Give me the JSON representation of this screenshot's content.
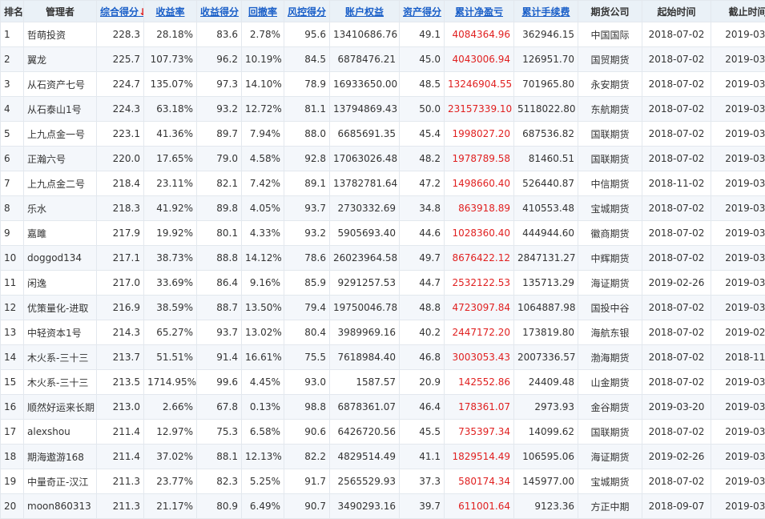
{
  "columns": [
    {
      "key": "rank",
      "label": "排名"
    },
    {
      "key": "manager",
      "label": "管理者"
    },
    {
      "key": "composite",
      "label": "综合得分",
      "sortable": true,
      "sort_indicator": "↓"
    },
    {
      "key": "return_rate",
      "label": "收益率",
      "sortable": true
    },
    {
      "key": "return_score",
      "label": "收益得分",
      "sortable": true
    },
    {
      "key": "drawdown",
      "label": "回撤率",
      "sortable": true
    },
    {
      "key": "risk_score",
      "label": "风控得分",
      "sortable": true
    },
    {
      "key": "equity",
      "label": "账户权益",
      "sortable": true
    },
    {
      "key": "asset_score",
      "label": "资产得分",
      "sortable": true
    },
    {
      "key": "net_profit",
      "label": "累计净盈亏",
      "sortable": true
    },
    {
      "key": "fees",
      "label": "累计手续费",
      "sortable": true
    },
    {
      "key": "broker",
      "label": "期货公司"
    },
    {
      "key": "start_date",
      "label": "起始时间"
    },
    {
      "key": "end_date",
      "label": "截止时间"
    }
  ],
  "accent_color": "#1a5fc8",
  "profit_color": "#e02020",
  "rows": [
    {
      "rank": "1",
      "manager": "哲萌投资",
      "composite": "228.3",
      "return_rate": "28.18%",
      "return_score": "83.6",
      "drawdown": "2.78%",
      "risk_score": "95.6",
      "equity": "13410686.76",
      "asset_score": "49.1",
      "net_profit": "4084364.96",
      "fees": "362946.15",
      "broker": "中国国际",
      "start_date": "2018-07-02",
      "end_date": "2019-03-28"
    },
    {
      "rank": "2",
      "manager": "翼龙",
      "composite": "225.7",
      "return_rate": "107.73%",
      "return_score": "96.2",
      "drawdown": "10.19%",
      "risk_score": "84.5",
      "equity": "6878476.21",
      "asset_score": "45.0",
      "net_profit": "4043006.94",
      "fees": "126951.70",
      "broker": "国贸期货",
      "start_date": "2018-07-02",
      "end_date": "2019-03-28"
    },
    {
      "rank": "3",
      "manager": "从石资产七号",
      "composite": "224.7",
      "return_rate": "135.07%",
      "return_score": "97.3",
      "drawdown": "14.10%",
      "risk_score": "78.9",
      "equity": "16933650.00",
      "asset_score": "48.5",
      "net_profit": "13246904.55",
      "fees": "701965.80",
      "broker": "永安期货",
      "start_date": "2018-07-02",
      "end_date": "2019-03-28"
    },
    {
      "rank": "4",
      "manager": "从石泰山1号",
      "composite": "224.3",
      "return_rate": "63.18%",
      "return_score": "93.2",
      "drawdown": "12.72%",
      "risk_score": "81.1",
      "equity": "13794869.43",
      "asset_score": "50.0",
      "net_profit": "23157339.10",
      "fees": "5118022.80",
      "broker": "东航期货",
      "start_date": "2018-07-02",
      "end_date": "2019-03-28"
    },
    {
      "rank": "5",
      "manager": "上九点金一号",
      "composite": "223.1",
      "return_rate": "41.36%",
      "return_score": "89.7",
      "drawdown": "7.94%",
      "risk_score": "88.0",
      "equity": "6685691.35",
      "asset_score": "45.4",
      "net_profit": "1998027.20",
      "fees": "687536.82",
      "broker": "国联期货",
      "start_date": "2018-07-02",
      "end_date": "2019-03-28"
    },
    {
      "rank": "6",
      "manager": "正瀚六号",
      "composite": "220.0",
      "return_rate": "17.65%",
      "return_score": "79.0",
      "drawdown": "4.58%",
      "risk_score": "92.8",
      "equity": "17063026.48",
      "asset_score": "48.2",
      "net_profit": "1978789.58",
      "fees": "81460.51",
      "broker": "国联期货",
      "start_date": "2018-07-02",
      "end_date": "2019-03-28"
    },
    {
      "rank": "7",
      "manager": "上九点金二号",
      "composite": "218.4",
      "return_rate": "23.11%",
      "return_score": "82.1",
      "drawdown": "7.42%",
      "risk_score": "89.1",
      "equity": "13782781.64",
      "asset_score": "47.2",
      "net_profit": "1498660.40",
      "fees": "526440.87",
      "broker": "中信期货",
      "start_date": "2018-11-02",
      "end_date": "2019-03-28"
    },
    {
      "rank": "8",
      "manager": "乐水",
      "composite": "218.3",
      "return_rate": "41.92%",
      "return_score": "89.8",
      "drawdown": "4.05%",
      "risk_score": "93.7",
      "equity": "2730332.69",
      "asset_score": "34.8",
      "net_profit": "863918.89",
      "fees": "410553.48",
      "broker": "宝城期货",
      "start_date": "2018-07-02",
      "end_date": "2019-03-28"
    },
    {
      "rank": "9",
      "manager": "嘉雎",
      "composite": "217.9",
      "return_rate": "19.92%",
      "return_score": "80.1",
      "drawdown": "4.33%",
      "risk_score": "93.2",
      "equity": "5905693.40",
      "asset_score": "44.6",
      "net_profit": "1028360.40",
      "fees": "444944.60",
      "broker": "徽商期货",
      "start_date": "2018-07-02",
      "end_date": "2019-03-28"
    },
    {
      "rank": "10",
      "manager": "doggod134",
      "composite": "217.1",
      "return_rate": "38.73%",
      "return_score": "88.8",
      "drawdown": "14.12%",
      "risk_score": "78.6",
      "equity": "26023964.58",
      "asset_score": "49.7",
      "net_profit": "8676422.12",
      "fees": "2847131.27",
      "broker": "中辉期货",
      "start_date": "2018-07-02",
      "end_date": "2019-03-28"
    },
    {
      "rank": "11",
      "manager": "闲逸",
      "composite": "217.0",
      "return_rate": "33.69%",
      "return_score": "86.4",
      "drawdown": "9.16%",
      "risk_score": "85.9",
      "equity": "9291257.53",
      "asset_score": "44.7",
      "net_profit": "2532122.53",
      "fees": "135713.29",
      "broker": "海证期货",
      "start_date": "2019-02-26",
      "end_date": "2019-03-28"
    },
    {
      "rank": "12",
      "manager": "优策量化-进取",
      "composite": "216.9",
      "return_rate": "38.59%",
      "return_score": "88.7",
      "drawdown": "13.50%",
      "risk_score": "79.4",
      "equity": "19750046.78",
      "asset_score": "48.8",
      "net_profit": "4723097.84",
      "fees": "1064887.98",
      "broker": "国投中谷",
      "start_date": "2018-07-02",
      "end_date": "2019-03-05"
    },
    {
      "rank": "13",
      "manager": "中轻资本1号",
      "composite": "214.3",
      "return_rate": "65.27%",
      "return_score": "93.7",
      "drawdown": "13.02%",
      "risk_score": "80.4",
      "equity": "3989969.16",
      "asset_score": "40.2",
      "net_profit": "2447172.20",
      "fees": "173819.80",
      "broker": "海航东银",
      "start_date": "2018-07-02",
      "end_date": "2019-02-22"
    },
    {
      "rank": "14",
      "manager": "木火系-三十三",
      "composite": "213.7",
      "return_rate": "51.51%",
      "return_score": "91.4",
      "drawdown": "16.61%",
      "risk_score": "75.5",
      "equity": "7618984.40",
      "asset_score": "46.8",
      "net_profit": "3003053.43",
      "fees": "2007336.57",
      "broker": "渤海期货",
      "start_date": "2018-07-02",
      "end_date": "2018-11-26"
    },
    {
      "rank": "15",
      "manager": "木火系-三十三",
      "composite": "213.5",
      "return_rate": "1714.95%",
      "return_score": "99.6",
      "drawdown": "4.45%",
      "risk_score": "93.0",
      "equity": "1587.57",
      "asset_score": "20.9",
      "net_profit": "142552.86",
      "fees": "24409.48",
      "broker": "山金期货",
      "start_date": "2018-07-02",
      "end_date": "2019-03-28"
    },
    {
      "rank": "16",
      "manager": "顺然好运来长期",
      "composite": "213.0",
      "return_rate": "2.66%",
      "return_score": "67.8",
      "drawdown": "0.13%",
      "risk_score": "98.8",
      "equity": "6878361.07",
      "asset_score": "46.4",
      "net_profit": "178361.07",
      "fees": "2973.93",
      "broker": "金谷期货",
      "start_date": "2019-03-20",
      "end_date": "2019-03-28"
    },
    {
      "rank": "17",
      "manager": "alexshou",
      "composite": "211.4",
      "return_rate": "12.97%",
      "return_score": "75.3",
      "drawdown": "6.58%",
      "risk_score": "90.6",
      "equity": "6426720.56",
      "asset_score": "45.5",
      "net_profit": "735397.34",
      "fees": "14099.62",
      "broker": "国联期货",
      "start_date": "2018-07-02",
      "end_date": "2019-03-28"
    },
    {
      "rank": "18",
      "manager": "期海遨游168",
      "composite": "211.4",
      "return_rate": "37.02%",
      "return_score": "88.1",
      "drawdown": "12.13%",
      "risk_score": "82.2",
      "equity": "4829514.49",
      "asset_score": "41.1",
      "net_profit": "1829514.49",
      "fees": "106595.06",
      "broker": "海证期货",
      "start_date": "2019-02-26",
      "end_date": "2019-03-28"
    },
    {
      "rank": "19",
      "manager": "中量奇正-汉江",
      "composite": "211.3",
      "return_rate": "23.77%",
      "return_score": "82.3",
      "drawdown": "5.25%",
      "risk_score": "91.7",
      "equity": "2565529.93",
      "asset_score": "37.3",
      "net_profit": "580174.34",
      "fees": "145977.00",
      "broker": "宝城期货",
      "start_date": "2018-07-02",
      "end_date": "2019-03-28"
    },
    {
      "rank": "20",
      "manager": "moon860313",
      "composite": "211.3",
      "return_rate": "21.17%",
      "return_score": "80.9",
      "drawdown": "6.49%",
      "risk_score": "90.7",
      "equity": "3490293.16",
      "asset_score": "39.7",
      "net_profit": "611001.64",
      "fees": "9123.36",
      "broker": "方正中期",
      "start_date": "2018-09-07",
      "end_date": "2019-03-28"
    }
  ]
}
